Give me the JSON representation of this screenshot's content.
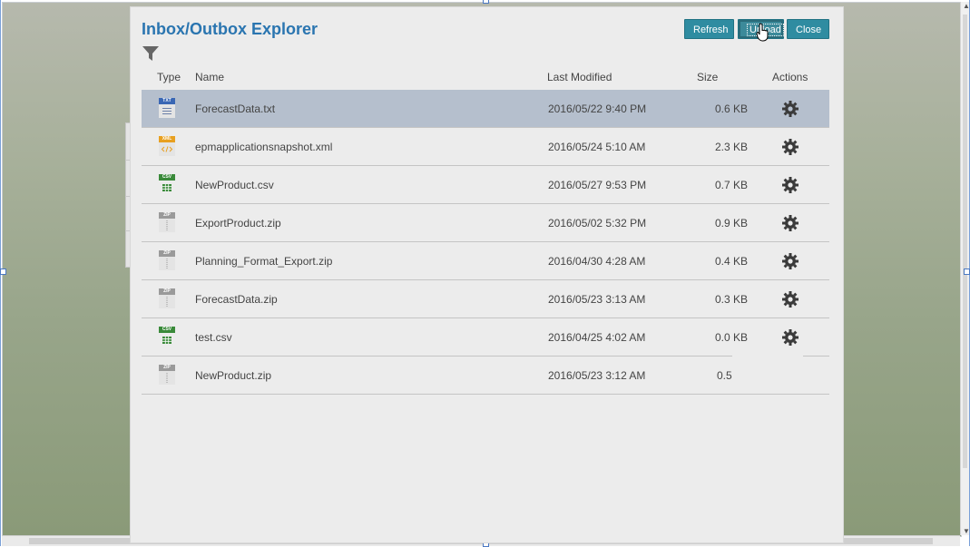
{
  "modal": {
    "title": "Inbox/Outbox Explorer",
    "buttons": {
      "refresh": "Refresh",
      "upload": "Upload",
      "close": "Close"
    }
  },
  "table": {
    "columns": {
      "type": "Type",
      "name": "Name",
      "modified": "Last Modified",
      "size": "Size",
      "actions": "Actions"
    },
    "rows": [
      {
        "type": "TXT",
        "name": "ForecastData.txt",
        "modified": "2016/05/22 9:40 PM",
        "size": "0.6 KB",
        "selected": true
      },
      {
        "type": "XML",
        "name": "epmapplicationsnapshot.xml",
        "modified": "2016/05/24 5:10 AM",
        "size": "2.3 KB"
      },
      {
        "type": "CSV",
        "name": "NewProduct.csv",
        "modified": "2016/05/27 9:53 PM",
        "size": "0.7 KB"
      },
      {
        "type": "ZIP",
        "name": "ExportProduct.zip",
        "modified": "2016/05/02 5:32 PM",
        "size": "0.9 KB"
      },
      {
        "type": "ZIP",
        "name": "Planning_Format_Export.zip",
        "modified": "2016/04/30 4:28 AM",
        "size": "0.4 KB"
      },
      {
        "type": "ZIP",
        "name": "ForecastData.zip",
        "modified": "2016/05/23 3:13 AM",
        "size": "0.3 KB"
      },
      {
        "type": "CSV",
        "name": "test.csv",
        "modified": "2016/04/25 4:02 AM",
        "size": "0.0 KB"
      },
      {
        "type": "ZIP",
        "name": "NewProduct.zip",
        "modified": "2016/05/23 3:12 AM",
        "size": "0.5"
      }
    ]
  },
  "icons": {
    "filter": "filter-icon",
    "actions": "gear-icon",
    "cursor": "hand-pointer-icon"
  },
  "colors": {
    "title": "#2a75b0",
    "button": "#2f8ca1",
    "selected_row": "#b5bfcd",
    "txt_tag": "#3a67b4",
    "xml_tag": "#e8a020",
    "csv_tag": "#3a8a3a",
    "zip_tag": "#9a9a9a"
  }
}
